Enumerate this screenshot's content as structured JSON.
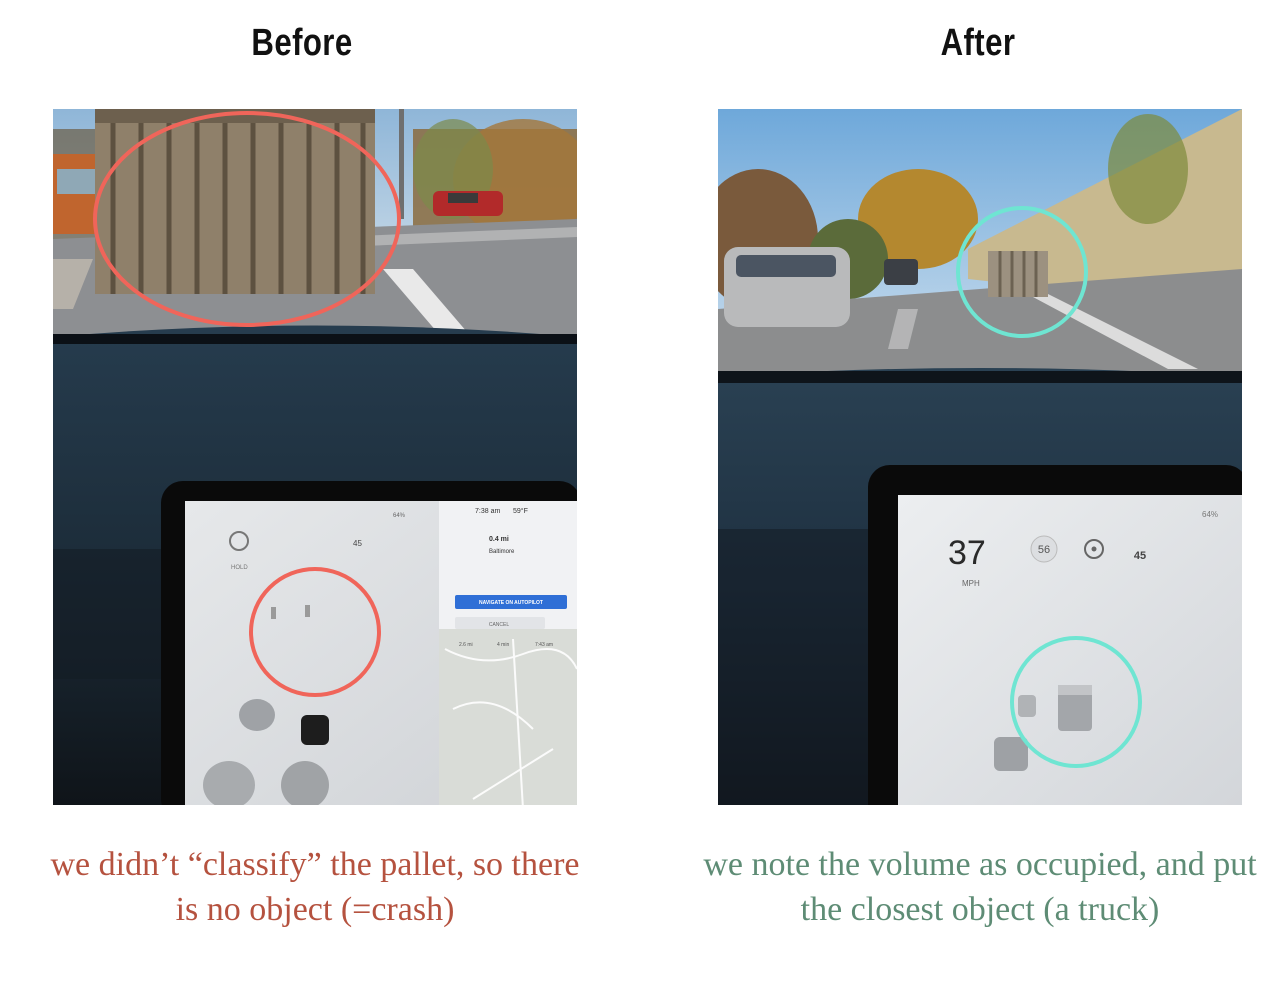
{
  "headings": {
    "before": "Before",
    "after": "After"
  },
  "colors": {
    "before_accent": "#f0655a",
    "after_accent": "#6fe5d2",
    "before_caption": "#b5523f",
    "after_caption": "#5e8c75"
  },
  "before": {
    "screen": {
      "battery": "64%",
      "time": "7:38 am",
      "temp": "59°F",
      "hold_label": "HOLD",
      "speed_limit": "45",
      "nav_distance": "0.4 mi",
      "nav_street": "Baltimore",
      "navigate_button": "NAVIGATE ON AUTOPILOT",
      "cancel_button": "CANCEL",
      "trip_miles": "2.6 mi",
      "trip_minutes": "4 min",
      "trip_arrival": "7:43 am"
    },
    "caption": "we didn’t “classify” the pallet, so there is no object (=crash)"
  },
  "after": {
    "screen": {
      "battery": "64%",
      "speed": "37",
      "speed_unit": "MPH",
      "set_speed": "56",
      "speed_limit": "45"
    },
    "caption": "we note the volume as occupied, and put the closest object (a truck)"
  }
}
